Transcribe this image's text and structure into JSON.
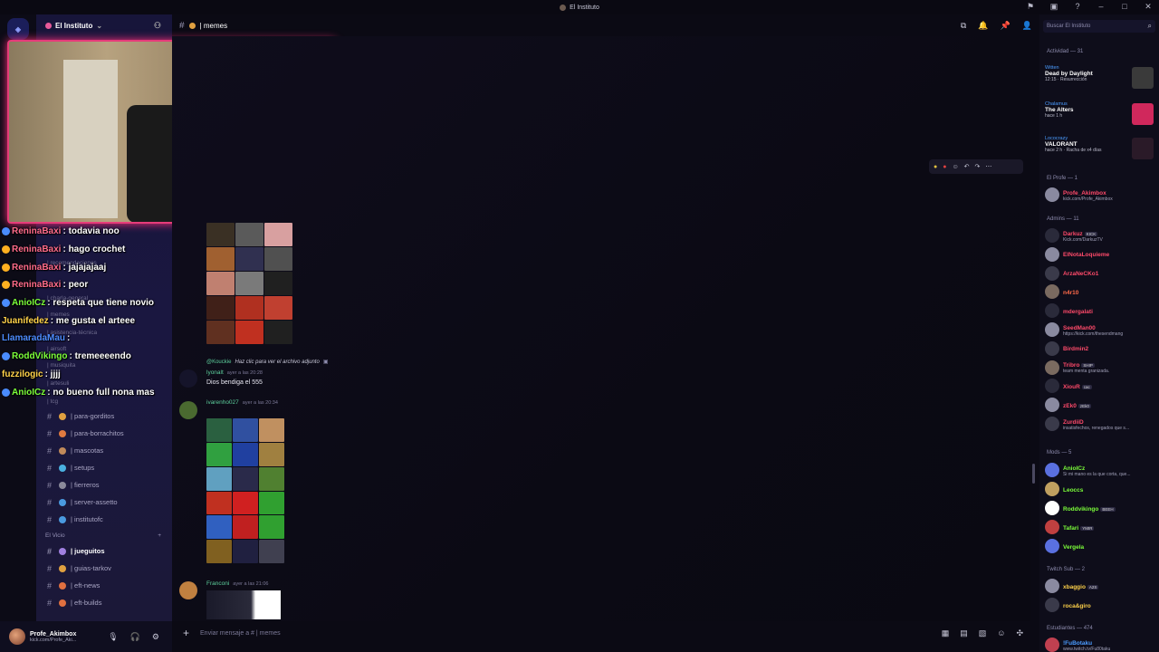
{
  "window": {
    "title": "El Instituto"
  },
  "server": {
    "name": "El Instituto"
  },
  "channel": {
    "name": "| memes"
  },
  "chat_overlay": [
    {
      "user": "ReninaBaxi",
      "color": "#ff6b8a",
      "text": ": todavia noo"
    },
    {
      "user": "ReninaBaxi",
      "color": "#ff6b8a",
      "text": ": hago crochet"
    },
    {
      "user": "ReninaBaxi",
      "color": "#ff6b8a",
      "text": ": jajajajaaj"
    },
    {
      "user": "ReninaBaxi",
      "color": "#ff6b8a",
      "text": ": peor"
    },
    {
      "user": "AnioICz",
      "color": "#7cff3a",
      "text": ": respeta que tiene novio"
    },
    {
      "user": "Juanifedez",
      "color": "#ffd24a",
      "text": ": me gusta el arteee"
    },
    {
      "user": "LlamaradaMau",
      "color": "#4d8cff",
      "text": ":"
    },
    {
      "user": "RoddVikingo",
      "color": "#7cff3a",
      "text": ": tremeeeendo"
    },
    {
      "user": "fuzzilogic",
      "color": "#ffd24a",
      "text": ": jjjj"
    },
    {
      "user": "AnioICz",
      "color": "#7cff3a",
      "text": ": no bueno full nona mas"
    }
  ],
  "faded_channels": [
    "| recomendaciones",
    "| charla-general",
    "| memes",
    "| asistencia-técnica",
    "| airsoft",
    "| musiquita",
    "| artesuli",
    "| tcg"
  ],
  "channels": [
    {
      "label": "| para-gorditos",
      "color": "#e0a040"
    },
    {
      "label": "| para-borrachitos",
      "color": "#e07a40"
    },
    {
      "label": "| mascotas",
      "color": "#c08a5a"
    },
    {
      "label": "| setups",
      "color": "#4ab0e0"
    },
    {
      "label": "| fierreros",
      "color": "#8a8a9a"
    },
    {
      "label": "| server-assetto",
      "color": "#4a9ae0"
    },
    {
      "label": "| institutofc",
      "color": "#4a9ae0"
    }
  ],
  "category2": "El Vicio",
  "channels2": [
    {
      "label": "| jueguitos",
      "color": "#a080e0",
      "active": true
    },
    {
      "label": "| guias-tarkov",
      "color": "#e0a040"
    },
    {
      "label": "| eft-news",
      "color": "#e07040"
    },
    {
      "label": "| eft-builds",
      "color": "#e07040"
    }
  ],
  "user": {
    "name": "Profe_Akimbox",
    "status": "kick.com/Profe_Aki..."
  },
  "messages": {
    "reply": {
      "author": "@Kouckie",
      "text": "Haz clic para ver el archivo adjunto"
    },
    "m1": {
      "author": "lyonalt",
      "time": "ayer a las 20:28",
      "text": "Dios bendiga el 555"
    },
    "m2": {
      "author": "ivarenho027",
      "time": "ayer a las 20:34"
    },
    "m3": {
      "author": "Franconi",
      "time": "ayer a las 21:06"
    }
  },
  "composer": {
    "placeholder": "Enviar mensaje a #",
    "channel": "| memes"
  },
  "search": {
    "placeholder": "Buscar El Instituto"
  },
  "members": {
    "activity_header": "Actividad — 31",
    "activities": [
      {
        "who": "Witten",
        "game": "Dead by Daylight",
        "meta": "12:15 · Resurrección",
        "thumb": "#3a3a3a"
      },
      {
        "who": "Chalamus",
        "game": "The Alters",
        "meta": "hace 1 h",
        "thumb": "#d0285c"
      },
      {
        "who": "Lococrazy",
        "game": "VALORANT",
        "meta": "hace 2 h · Racha de x4 días",
        "thumb": "#2a1a28"
      }
    ],
    "profe_header": "El Profe — 1",
    "profe": [
      {
        "name": "Profe_Akimbox",
        "sub": "kick.com/Profe_Akimbox",
        "color": "#ff4a6a"
      }
    ],
    "admins_header": "Admins — 11",
    "admins": [
      {
        "name": "Darkuz",
        "sub": "Kick.com/DarkuzTV",
        "color": "#ff4a6a",
        "tag": "KICK"
      },
      {
        "name": "ElNotaLoquieme",
        "sub": "",
        "color": "#ff4a6a"
      },
      {
        "name": "ArzaNeCKo1",
        "sub": "",
        "color": "#ff4a6a"
      },
      {
        "name": "n4r10",
        "sub": "",
        "color": "#ff6a4a"
      },
      {
        "name": "mdergalati",
        "sub": "",
        "color": "#ff4a6a"
      },
      {
        "name": "SeedMan00",
        "sub": "https://kick.com/thesendmang",
        "color": "#ff4a6a"
      },
      {
        "name": "Birdmin2",
        "sub": "",
        "color": "#ff4a6a"
      },
      {
        "name": "Tribro",
        "sub": "team menta granizada.",
        "color": "#ff4a6a",
        "tag": "SHIP"
      },
      {
        "name": "XiouR",
        "sub": "",
        "color": "#ff4a6a",
        "tag": "cac"
      },
      {
        "name": "zEk0",
        "sub": "",
        "color": "#ff4a6a",
        "tag": "zEk0"
      },
      {
        "name": "ZurdiiD",
        "sub": "insatisfechos, renegados que s...",
        "color": "#ff4a6a"
      }
    ],
    "mods_header": "Mods — 5",
    "mods": [
      {
        "name": "AnioICz",
        "sub": "Si mi mano es la que corta, que...",
        "color": "#7cff3a"
      },
      {
        "name": "Leoccs",
        "sub": "",
        "color": "#7cff3a"
      },
      {
        "name": "Roddvikingo",
        "sub": "",
        "color": "#7cff3a",
        "tag": "BEEH"
      },
      {
        "name": "Tafari",
        "sub": "",
        "color": "#7cff3a",
        "tag": "YMIR"
      },
      {
        "name": "Vergela",
        "sub": "",
        "color": "#7cff3a"
      }
    ],
    "twitch_header": "Twitch Sub — 2",
    "twitch": [
      {
        "name": "xbaggio",
        "sub": "",
        "color": "#ffd24a",
        "tag": "A2S"
      },
      {
        "name": "roca&giro",
        "sub": "",
        "color": "#ffd24a"
      }
    ],
    "students_header": "Estudiantes — 474",
    "students": [
      {
        "name": "!FuBotaku",
        "sub": "www.twitch.tv/Fu80taku",
        "color": "#4b9cff"
      }
    ]
  },
  "colors": {
    "accent": "#e63c7a",
    "bg": "#0b0a14",
    "sidebar": "#17153a"
  }
}
